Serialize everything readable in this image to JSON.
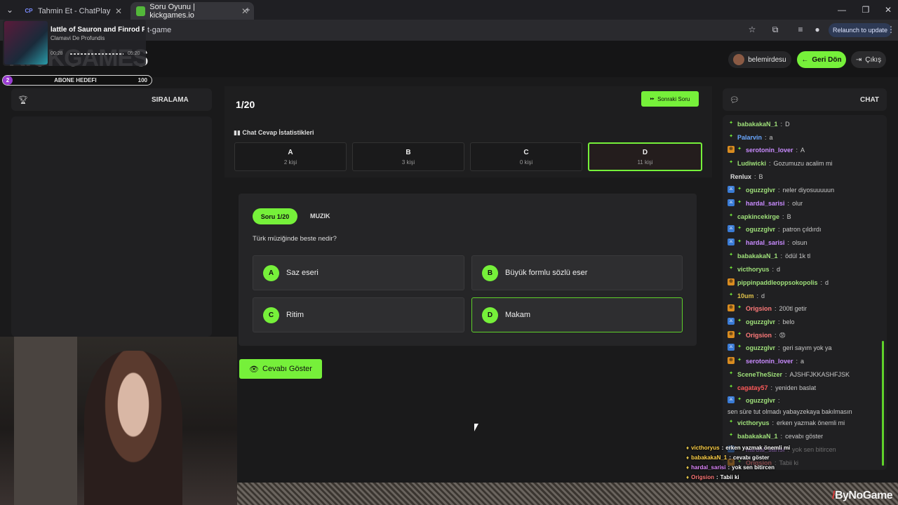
{
  "browser": {
    "tabs": [
      {
        "label": "Tahmin Et - ChatPlay",
        "favicon": "CP",
        "active": false
      },
      {
        "label": "Soru Oyunu | kickgames.io",
        "favicon": "",
        "active": true
      }
    ],
    "url_visible": "t-game",
    "relaunch_label": "Relaunch to update"
  },
  "media": {
    "title": "lattle of Sauron and Finrod Fe",
    "artist": "Clamavi De Profundis",
    "time_current": "00:28",
    "time_total": "05:20"
  },
  "header": {
    "logo_visible": "KICKGAMES",
    "user_name": "belemirdesu",
    "back_label": "Geri Dön",
    "logout_label": "Çıkış"
  },
  "goal": {
    "count": "2",
    "label": "ABONE HEDEFI",
    "target": "100"
  },
  "leaderboard": {
    "title": "SIRALAMA"
  },
  "game": {
    "question_counter": "1/20",
    "next_label": "Sonraki Soru",
    "stats_title": "Chat Cevap İstatistikleri",
    "stats": [
      {
        "letter": "A",
        "count": "2 kişi"
      },
      {
        "letter": "B",
        "count": "3 kişi"
      },
      {
        "letter": "C",
        "count": "0 kişi"
      },
      {
        "letter": "D",
        "count": "11 kişi"
      }
    ],
    "question_pill": "Soru 1/20",
    "category": "MUZIK",
    "question": "Türk müziğinde beste nedir?",
    "options": [
      {
        "letter": "A",
        "text": "Saz eseri"
      },
      {
        "letter": "B",
        "text": "Büyük formlu sözlü eser"
      },
      {
        "letter": "C",
        "text": "Ritim"
      },
      {
        "letter": "D",
        "text": "Makam"
      }
    ],
    "show_answer_label": "Cevabı Göster"
  },
  "chat": {
    "title": "CHAT",
    "messages": [
      {
        "user": "babakakaN_1",
        "text": "D",
        "color": "#9fe07a",
        "badges": [
          "g"
        ]
      },
      {
        "user": "Palarvin",
        "text": "a",
        "color": "#6aa8ff",
        "badges": [
          "g"
        ]
      },
      {
        "user": "serotonin_lover",
        "text": "A",
        "color": "#c98bff",
        "badges": [
          "o",
          "g"
        ]
      },
      {
        "user": "Ludiwicki",
        "text": "Gozumuzu acalim mi",
        "color": "#9fe07a",
        "badges": [
          "g"
        ]
      },
      {
        "user": "Renlux",
        "text": "B",
        "color": "#dddddd",
        "badges": []
      },
      {
        "user": "oguzzglvr",
        "text": "neler diyosuuuuun",
        "color": "#9fe07a",
        "badges": [
          "b",
          "g"
        ]
      },
      {
        "user": "hardal_sarisi",
        "text": "olur",
        "color": "#c98bff",
        "badges": [
          "b",
          "g"
        ]
      },
      {
        "user": "capkincekirge",
        "text": "B",
        "color": "#9fe07a",
        "badges": [
          "g"
        ]
      },
      {
        "user": "oguzzglvr",
        "text": "patron çıldırdı",
        "color": "#9fe07a",
        "badges": [
          "b",
          "g"
        ]
      },
      {
        "user": "hardal_sarisi",
        "text": "olsun",
        "color": "#c98bff",
        "badges": [
          "b",
          "g"
        ]
      },
      {
        "user": "babakakaN_1",
        "text": "ödül 1k tl",
        "color": "#9fe07a",
        "badges": [
          "g"
        ]
      },
      {
        "user": "victhoryus",
        "text": "d",
        "color": "#9fe07a",
        "badges": [
          "g"
        ]
      },
      {
        "user": "pippinpaddleoppsokopolis",
        "text": "d",
        "color": "#9fe07a",
        "badges": [
          "o"
        ]
      },
      {
        "user": "10um",
        "text": "d",
        "color": "#e0c24a",
        "badges": [
          "g"
        ]
      },
      {
        "user": "Origsion",
        "text": "200tl getir",
        "color": "#ff7a7a",
        "badges": [
          "o",
          "g"
        ]
      },
      {
        "user": "oguzzglvr",
        "text": "belo",
        "color": "#9fe07a",
        "badges": [
          "b",
          "g"
        ]
      },
      {
        "user": "Origsion",
        "text": "",
        "color": "#ff7a7a",
        "badges": [
          "o",
          "g"
        ]
      },
      {
        "user": "oguzzglvr",
        "text": "geri sayım yok ya",
        "color": "#9fe07a",
        "badges": [
          "b",
          "g"
        ]
      },
      {
        "user": "serotonin_lover",
        "text": "a",
        "color": "#c98bff",
        "badges": [
          "o",
          "g"
        ]
      },
      {
        "user": "SceneTheSizer",
        "text": "AJSHFJKKASHFJSK",
        "color": "#9fe07a",
        "badges": [
          "g"
        ]
      },
      {
        "user": "cagatay57",
        "text": "yeniden baslat",
        "color": "#ff5a5a",
        "badges": [
          "g"
        ]
      },
      {
        "user": "oguzzglvr",
        "text": "sen süre tut olmadı yabayzekaya bakılmasın",
        "color": "#9fe07a",
        "badges": [
          "b",
          "g"
        ]
      },
      {
        "user": "victhoryus",
        "text": "erken yazmak önemli mi",
        "color": "#9fe07a",
        "badges": [
          "g"
        ]
      },
      {
        "user": "babakakaN_1",
        "text": "cevabı göster",
        "color": "#9fe07a",
        "badges": [
          "g"
        ]
      },
      {
        "user": "hardal_sarisi",
        "text": "yok sen bitircen",
        "color": "#c98bff",
        "badges": [
          "b",
          "g"
        ]
      },
      {
        "user": "Origsion",
        "text": "Tabii ki",
        "color": "#ff7a7a",
        "badges": [
          "o",
          "g"
        ]
      }
    ]
  },
  "overlay_chat": [
    {
      "user": "victhoryus",
      "text": "erken yazmak önemli mi",
      "color": "#ffd24a"
    },
    {
      "user": "babakakaN_1",
      "text": "cevabı göster",
      "color": "#ffd24a"
    },
    {
      "user": "hardal_sarisi",
      "text": "yok sen bitircen",
      "color": "#e08aff"
    },
    {
      "user": "Origsion",
      "text": "Tabii ki",
      "color": "#ff7a7a"
    }
  ],
  "watermark": {
    "a": "ByNo",
    "b": "Game"
  },
  "colors": {
    "accent": "#76f03a"
  }
}
